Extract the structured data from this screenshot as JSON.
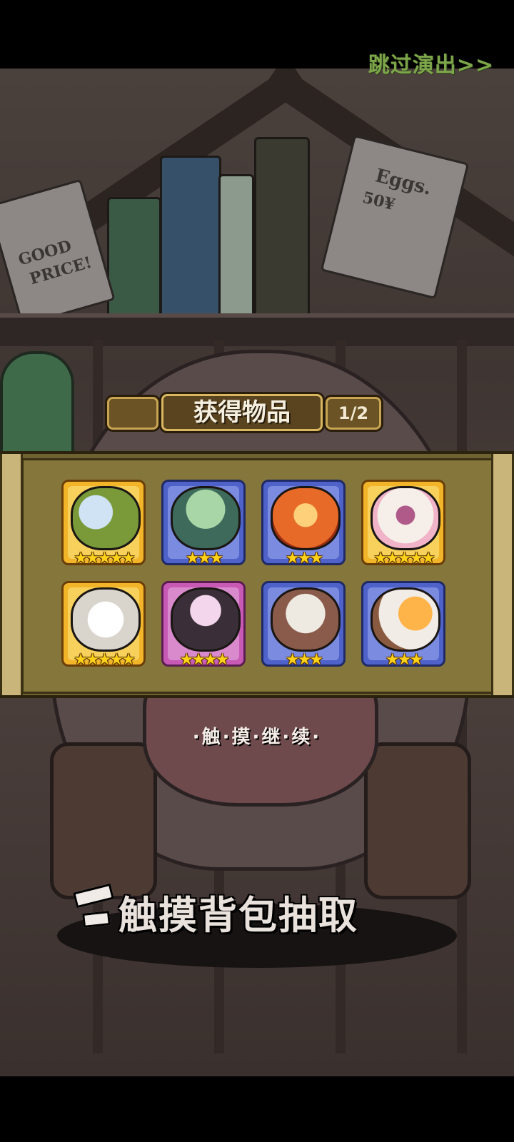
{
  "skip_button": {
    "label": "跳过演出>>"
  },
  "background": {
    "sign_left": [
      "GOOD",
      "PRICE!"
    ],
    "sign_right": [
      "Eggs.",
      "50¥"
    ]
  },
  "result_panel": {
    "title": "获得物品",
    "page_indicator": "1/2",
    "items": [
      {
        "name": "wing-item",
        "rarity": "gold",
        "stars": "★★★★★",
        "color": "#7a9a3a"
      },
      {
        "name": "cloak-item",
        "rarity": "blue",
        "stars": "★★★",
        "color": "#7fb48a"
      },
      {
        "name": "flame-item",
        "rarity": "blue",
        "stars": "★★★",
        "color": "#e86a28"
      },
      {
        "name": "heart-egg-item",
        "rarity": "gold",
        "stars": "★★★★★",
        "color": "#f0b3c8"
      },
      {
        "name": "bow-item",
        "rarity": "gold",
        "stars": "★★★★★",
        "color": "#e8e4e0"
      },
      {
        "name": "mask-item",
        "rarity": "purple",
        "stars": "★★★★",
        "color": "#b06aa6"
      },
      {
        "name": "skull-item",
        "rarity": "blue",
        "stars": "★★★",
        "color": "#dcd8cf"
      },
      {
        "name": "fire-horn-item",
        "rarity": "blue",
        "stars": "★★★",
        "color": "#f0a040"
      }
    ]
  },
  "continue_hint": "·触·摸·继·续·",
  "bag_hint": "触摸背包抽取",
  "colors": {
    "skip_text": "#7da64a",
    "panel": "#6e6231",
    "gold_frame": "#f2b529",
    "blue_frame": "#4f62c9",
    "purple_frame": "#c85ab6"
  }
}
